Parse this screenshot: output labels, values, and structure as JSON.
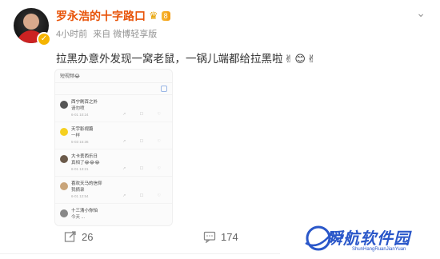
{
  "post": {
    "author": "罗永浩的十字路口",
    "vip_badge": "8",
    "time": "4小时前",
    "source": "来自 微博轻享版",
    "text": "拉黑办意外发现一窝老鼠，一锅儿端都给拉黑啦",
    "emojis": [
      "✌",
      "😊",
      "✌"
    ]
  },
  "screenshot": {
    "top_text": "短视频😂",
    "rows": [
      {
        "name": "西宁刷百之外",
        "msg": "请勿喷",
        "date": "6-01 10:24",
        "actions": "↗ ☐ ♡"
      },
      {
        "name": "天宇影视篇",
        "msg": "一样",
        "date": "5-03 15:36",
        "actions": "↗ ☐ ♡"
      },
      {
        "name": "大卡丢西乐日",
        "msg": "真相了😂😂😂",
        "date": "6-01 13:21",
        "actions": "↗ ☐ ♡"
      },
      {
        "name": "喜欢天马的信仰",
        "msg": "我摘录",
        "date": "6-01 12:54",
        "actions": "↗ ☐ ♡"
      },
      {
        "name": "十三清小你怕",
        "msg": "今天 ...",
        "date": "",
        "actions": ""
      }
    ]
  },
  "footer": {
    "repost_count": "26",
    "comment_count": "174"
  },
  "watermark": {
    "title": "瞬航软件园",
    "subtitle": "ShunHangRuanJianYuan"
  },
  "colors": {
    "name": "#e8540a",
    "watermark": "#2a57c9"
  }
}
